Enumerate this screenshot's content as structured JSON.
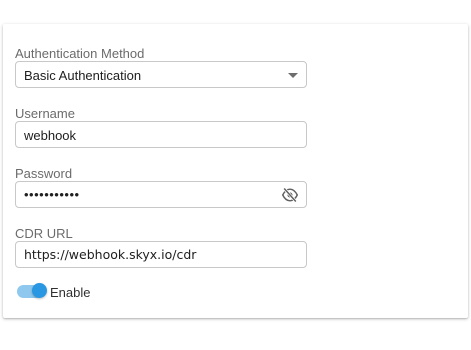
{
  "form": {
    "auth_method": {
      "label": "Authentication Method",
      "value": "Basic Authentication"
    },
    "username": {
      "label": "Username",
      "value": "webhook"
    },
    "password": {
      "label": "Password",
      "value": "•••••••••••",
      "visibility_icon": "eye-off-icon"
    },
    "cdr_url": {
      "label": "CDR URL",
      "value": "https://webhook.skyx.io/cdr"
    },
    "enable": {
      "label": "Enable",
      "checked": true
    }
  },
  "colors": {
    "toggle_track": "#8ec8ee",
    "toggle_thumb": "#2a97e3"
  }
}
